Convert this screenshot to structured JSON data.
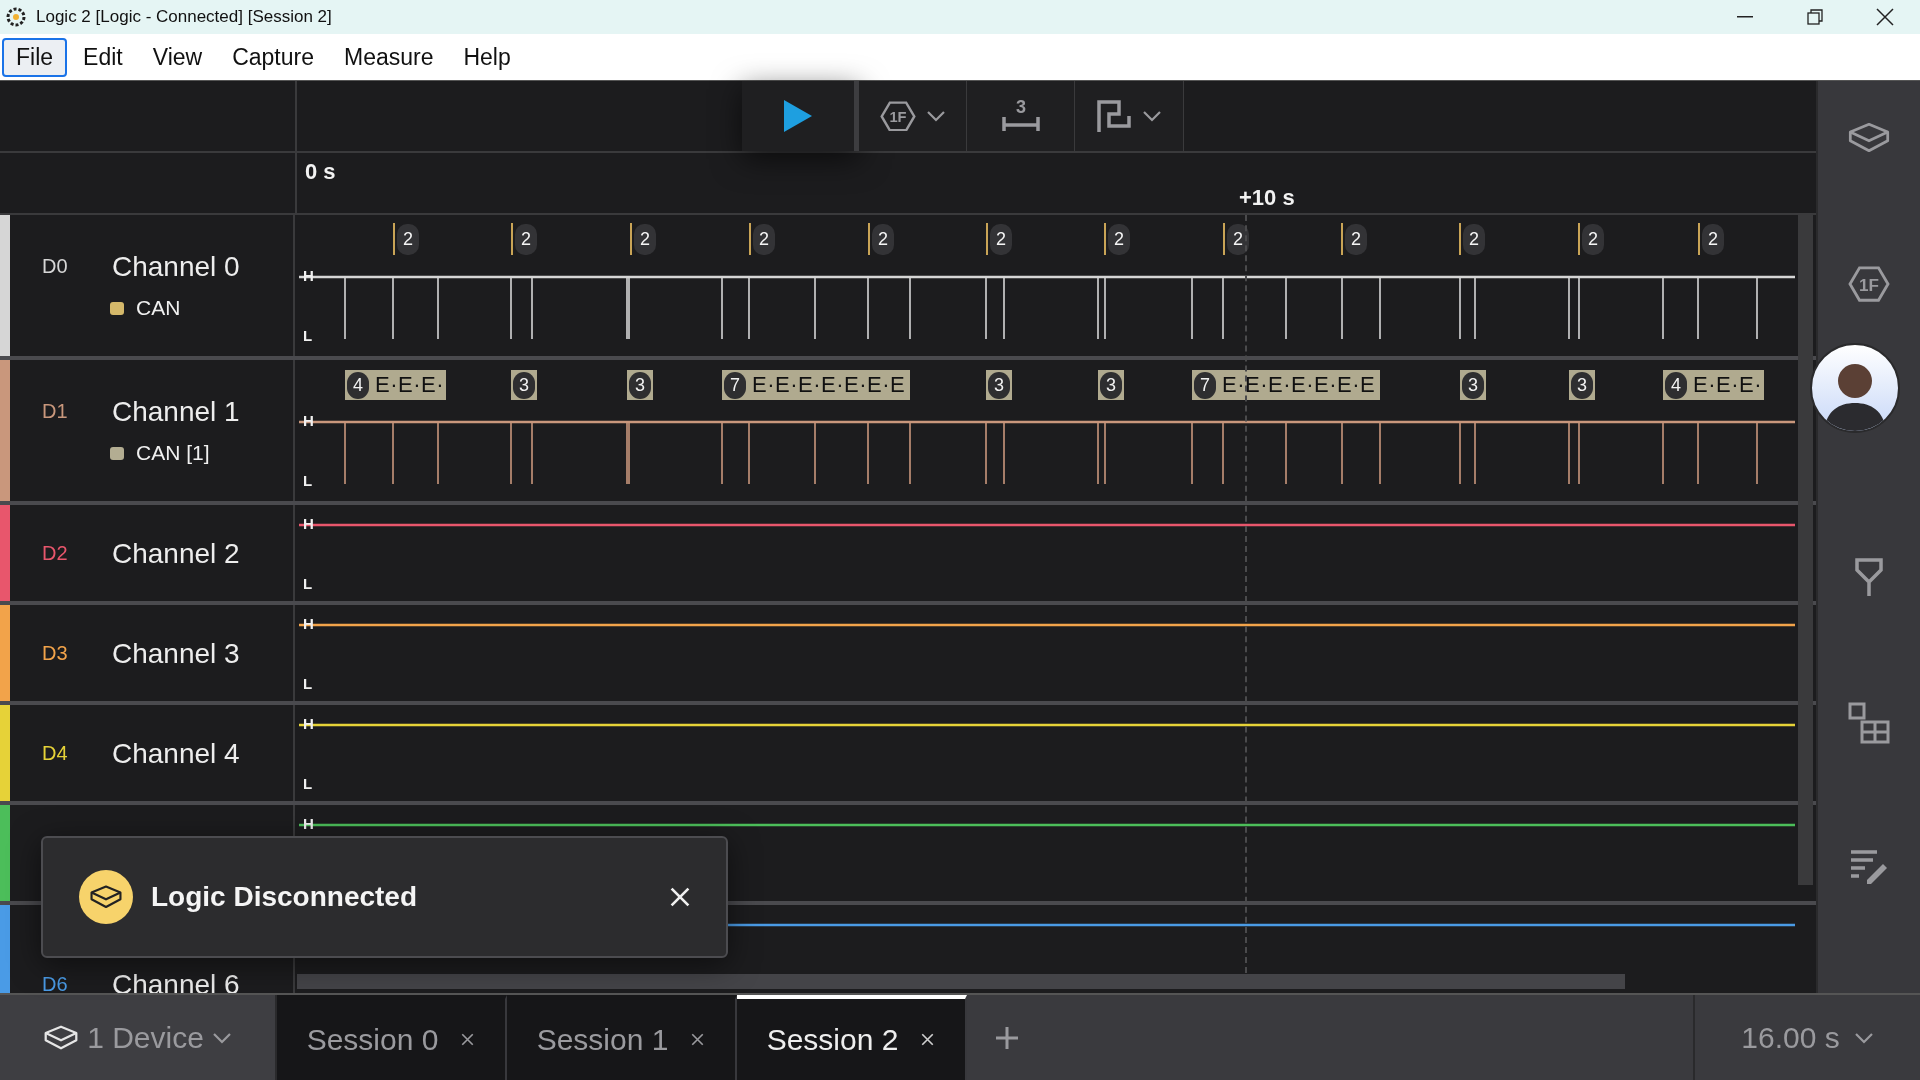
{
  "window": {
    "title": "Logic 2 [Logic - Connected] [Session 2]"
  },
  "menu": [
    {
      "label": "File",
      "selected": true
    },
    {
      "label": "Edit",
      "selected": false
    },
    {
      "label": "View",
      "selected": false
    },
    {
      "label": "Capture",
      "selected": false
    },
    {
      "label": "Measure",
      "selected": false
    },
    {
      "label": "Help",
      "selected": false
    }
  ],
  "toolbar": {
    "trigger_icon_text": "1F",
    "measure_icon_text": "3"
  },
  "sidebar": {
    "analyzer_icon_text": "1F"
  },
  "ruler": {
    "start": "0 s",
    "mark": "+10 s"
  },
  "channels": [
    {
      "id": "D0",
      "name": "Channel 0",
      "color": "#d6d6d6",
      "high": "H",
      "low": "L",
      "analyzer": {
        "name": "CAN",
        "color": "#d4b86a"
      },
      "decoded": [
        {
          "kind": "marker",
          "badge": "2"
        },
        {
          "kind": "marker",
          "badge": "2"
        },
        {
          "kind": "marker",
          "badge": "2"
        },
        {
          "kind": "marker",
          "badge": "2"
        },
        {
          "kind": "marker",
          "badge": "2"
        },
        {
          "kind": "marker",
          "badge": "2"
        },
        {
          "kind": "marker",
          "badge": "2"
        },
        {
          "kind": "marker",
          "badge": "2"
        },
        {
          "kind": "marker",
          "badge": "2"
        },
        {
          "kind": "marker",
          "badge": "2"
        },
        {
          "kind": "marker",
          "badge": "2"
        },
        {
          "kind": "marker",
          "badge": "2"
        }
      ]
    },
    {
      "id": "D1",
      "name": "Channel 1",
      "color": "#c9977c",
      "high": "H",
      "low": "L",
      "analyzer": {
        "name": "CAN [1]",
        "color": "#b3ad92"
      },
      "decoded": [
        {
          "kind": "frame",
          "badge": "4",
          "text": "E·E·E·"
        },
        {
          "kind": "frame",
          "badge": "3"
        },
        {
          "kind": "frame",
          "badge": "3"
        },
        {
          "kind": "frame",
          "badge": "7",
          "text": "E·E·E·E·E·E·E"
        },
        {
          "kind": "frame",
          "badge": "3"
        },
        {
          "kind": "frame",
          "badge": "3"
        },
        {
          "kind": "frame",
          "badge": "7",
          "text": "E·E·E·E·E·E·E"
        },
        {
          "kind": "frame",
          "badge": "3"
        },
        {
          "kind": "frame",
          "badge": "3"
        },
        {
          "kind": "frame",
          "badge": "4",
          "text": "E·E·E·"
        }
      ]
    },
    {
      "id": "D2",
      "name": "Channel 2",
      "color": "#e8566c",
      "high": "H",
      "low": "L"
    },
    {
      "id": "D3",
      "name": "Channel 3",
      "color": "#f2a34a",
      "high": "H",
      "low": "L"
    },
    {
      "id": "D4",
      "name": "Channel 4",
      "color": "#e6d238",
      "high": "H",
      "low": "L"
    },
    {
      "color": "#4cbe5a",
      "high": "H"
    },
    {
      "id": "D6",
      "name": "Channel 6",
      "color": "#4a9be6"
    }
  ],
  "toast": {
    "message": "Logic Disconnected"
  },
  "bottom_bar": {
    "device": "1 Device",
    "sessions": [
      {
        "label": "Session 0",
        "selected": false
      },
      {
        "label": "Session 1",
        "selected": false
      },
      {
        "label": "Session 2",
        "selected": true
      }
    ],
    "duration": "16.00 s"
  }
}
